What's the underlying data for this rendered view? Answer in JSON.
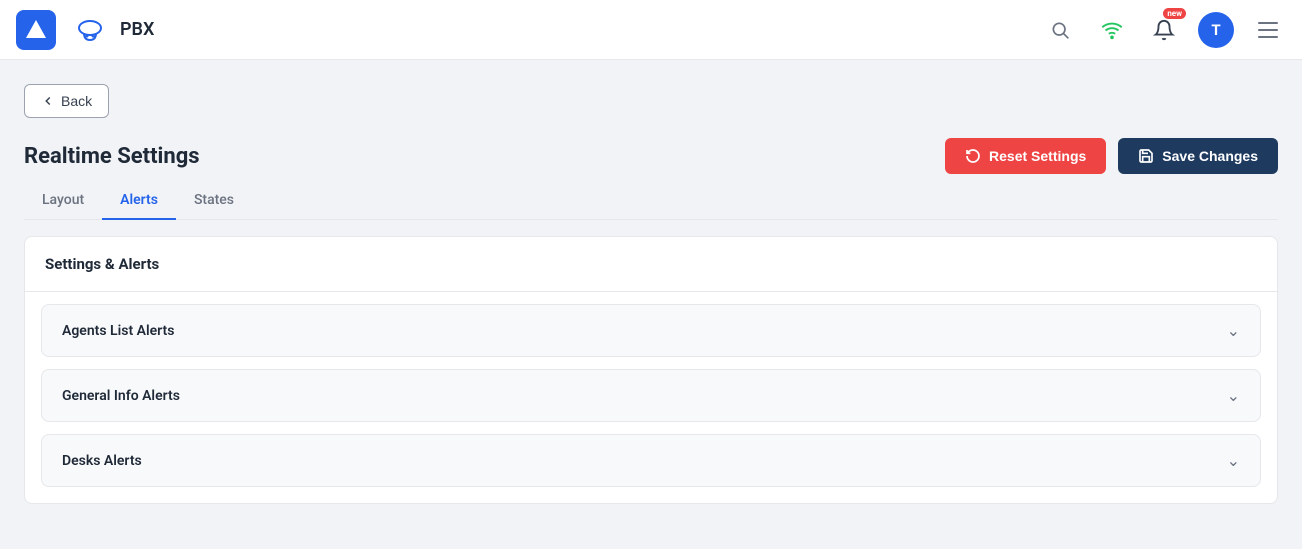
{
  "navbar": {
    "logo_letter": "▲",
    "app_title": "PBX",
    "search_label": "Search",
    "wifi_label": "Network Status",
    "notification_label": "Notifications",
    "notification_badge": "new",
    "avatar_letter": "T",
    "menu_label": "Menu"
  },
  "page": {
    "back_label": "Back",
    "title": "Realtime Settings",
    "reset_label": "Reset Settings",
    "save_label": "Save Changes"
  },
  "tabs": [
    {
      "id": "layout",
      "label": "Layout",
      "active": false
    },
    {
      "id": "alerts",
      "label": "Alerts",
      "active": true
    },
    {
      "id": "states",
      "label": "States",
      "active": false
    }
  ],
  "settings_section": {
    "header": "Settings & Alerts"
  },
  "accordions": [
    {
      "id": "agents-list-alerts",
      "label": "Agents List Alerts"
    },
    {
      "id": "general-info-alerts",
      "label": "General Info Alerts"
    },
    {
      "id": "desks-alerts",
      "label": "Desks Alerts"
    }
  ]
}
